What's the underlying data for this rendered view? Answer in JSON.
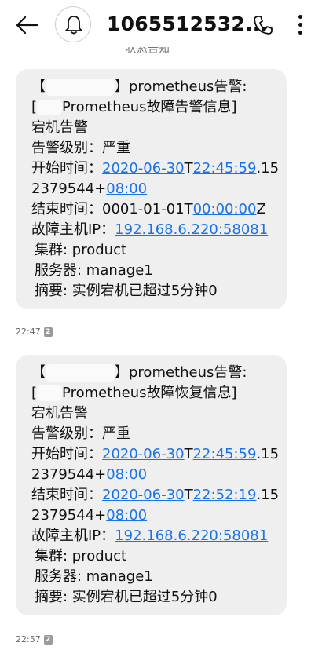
{
  "header": {
    "title": "1065512532...",
    "top_strip_text": "状态告知"
  },
  "messages": [
    {
      "lines": {
        "l1_suffix": "】prometheus告警:",
        "l2_suffix": "Prometheus故障告警信息]",
        "l3": "宕机告警",
        "l4": "告警级别：严重",
        "start_label": "开始时间：",
        "start_date": "2020-06-30",
        "start_T": "T",
        "start_time": "22:45:59",
        "start_frac": ".15",
        "start_cont": "2379544+",
        "start_tz": "08:00",
        "end_label": "结束时间：",
        "end_plain": "0001-01-01T",
        "end_time": "00:00:00",
        "end_tail": "Z",
        "ip_label": "故障主机IP：",
        "ip": "192.168.6.220:58081",
        "cluster": "集群: product",
        "server": "服务器: manage1",
        "summary": "摘要: 实例宕机已超过5分钟0"
      },
      "time": "22:47",
      "sim": "2"
    },
    {
      "lines": {
        "l1_suffix": "】prometheus告警:",
        "l2_suffix": "Prometheus故障恢复信息]",
        "l3": "宕机告警",
        "l4": "告警级别：严重",
        "start_label": "开始时间：",
        "start_date": "2020-06-30",
        "start_T": "T",
        "start_time": "22:45:59",
        "start_frac": ".15",
        "start_cont": "2379544+",
        "start_tz": "08:00",
        "end_label": "结束时间：",
        "end_date": "2020-06-30",
        "end_T": "T",
        "end_time": "22:52:19",
        "end_frac": ".15",
        "end_cont": "2379544+",
        "end_tz": "08:00",
        "ip_label": "故障主机IP：",
        "ip": "192.168.6.220:58081",
        "cluster": "集群: product",
        "server": "服务器: manage1",
        "summary": "摘要: 实例宕机已超过5分钟0"
      },
      "time": "22:57",
      "sim": "2"
    }
  ],
  "icons": {
    "back": "arrow-left-icon",
    "notify": "bell-icon",
    "call": "phone-icon",
    "menu": "more-vertical-icon"
  }
}
